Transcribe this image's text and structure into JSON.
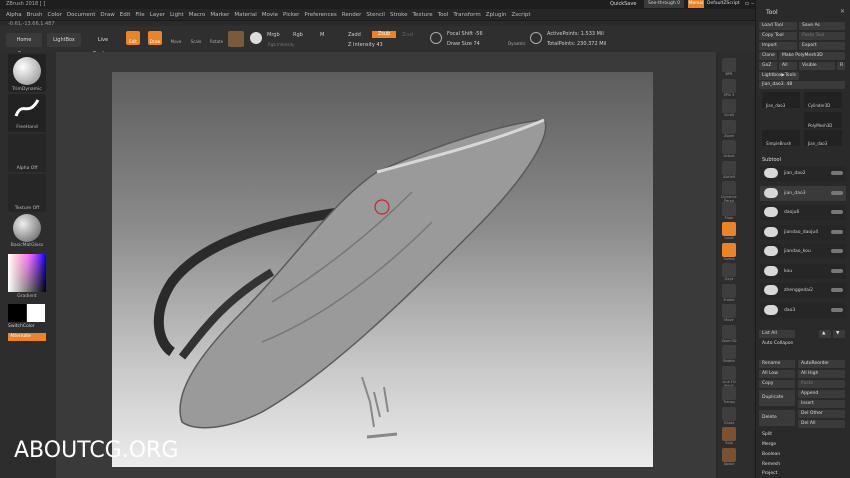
{
  "title": "ZBrush 2018 [ ]",
  "quicksave": "QuickSave",
  "see_through": "See-through  0",
  "menus_btn": "Menus",
  "default_script": "DefaultZScript",
  "menu": [
    "Alpha",
    "Brush",
    "Color",
    "Document",
    "Draw",
    "Edit",
    "File",
    "Layer",
    "Light",
    "Macro",
    "Marker",
    "Material",
    "Movie",
    "Picker",
    "Preferences",
    "Render",
    "Stencil",
    "Stroke",
    "Texture",
    "Tool",
    "Transform",
    "Zplugin",
    "Zscript"
  ],
  "coords": "-0.61,-13.66,1.487",
  "toolbar": {
    "home": "Home Page",
    "lightbox": "LightBox",
    "live_boolean": "Live Boolean",
    "edit": "Edit",
    "draw": "Draw",
    "move": "Move",
    "scale": "Scale",
    "rotate": "Rotate",
    "mrgb": "Mrgb",
    "rgb": "Rgb",
    "m": "M",
    "zadd": "Zadd",
    "zsub": "Zsub",
    "zcut": "Zcut",
    "rgb_intensity": "Rgb Intensity",
    "z_intensity": "Z Intensity 43",
    "focal_shift": "Focal Shift -56",
    "draw_size": "Draw Size 74",
    "dynamic": "Dynamic",
    "active_points": "ActivePoints: 1.533 Mil",
    "total_points": "TotalPoints: 230.372 Mil"
  },
  "left": {
    "brush": "TrimDynamic",
    "stroke": "FreeHand",
    "alpha": "Alpha Off",
    "texture": "Texture Off",
    "material": "BasicMatGloss",
    "gradient": "Gradient",
    "switch_color": "SwitchColor",
    "alternate": "Alternate"
  },
  "right_shelf": [
    "BPR",
    "SPix 3",
    "Scroll",
    "Zoom",
    "Actual",
    "AAHalf",
    "Dynamic Persp",
    "Floor",
    "Local",
    "Gizmo",
    "Qxyz",
    "Frame",
    "Move",
    "Zoom3D",
    "Rotate",
    "Line Fill PolyF",
    "Transp",
    "Ghost",
    "Solo",
    "Xpose"
  ],
  "tool_panel": {
    "title": "Tool",
    "load": "Load Tool",
    "save": "Save As",
    "copy": "Copy Tool",
    "paste": "Paste Tool",
    "import": "Import",
    "export": "Export",
    "clone": "Clone",
    "make_poly": "Make PolyMesh3D",
    "goz": "GoZ",
    "all": "All",
    "visible": "Visible",
    "r": "R",
    "lightbox_tools": "Lightbox▶Tools",
    "current": "Jian_dao3. 48",
    "thumbs": [
      "Jian_dao3",
      "Cylinder3D",
      "PolyMesh3D",
      "SimpleBrush",
      "Jian_dao3"
    ],
    "thumb_count": "2",
    "thumb_count2": "92",
    "subtool": "Subtool",
    "subtools": [
      "jian_dao2",
      "jian_dao3",
      "daoju6",
      "jiandao_daoju4",
      "jiandao_kou",
      "kou",
      "zhenggedai2",
      "dao3"
    ],
    "list_all": "List All",
    "auto_collapse": "Auto Collapse",
    "rename": "Rename",
    "auto_reorder": "AutoReorder",
    "all_low": "All Low",
    "all_high": "All High",
    "copy2": "Copy",
    "paste2": "Paste",
    "duplicate": "Duplicate",
    "append": "Append",
    "insert": "Insert",
    "delete": "Delete",
    "del_other": "Del Other",
    "del_all": "Del All",
    "split": "Split",
    "merge": "Merge",
    "boolean": "Boolean",
    "remesh": "Remesh",
    "project": "Project"
  },
  "watermark": "ABOUTCG.ORG",
  "colors": {
    "accent": "#e8842c",
    "bg": "#2b2b2b"
  }
}
